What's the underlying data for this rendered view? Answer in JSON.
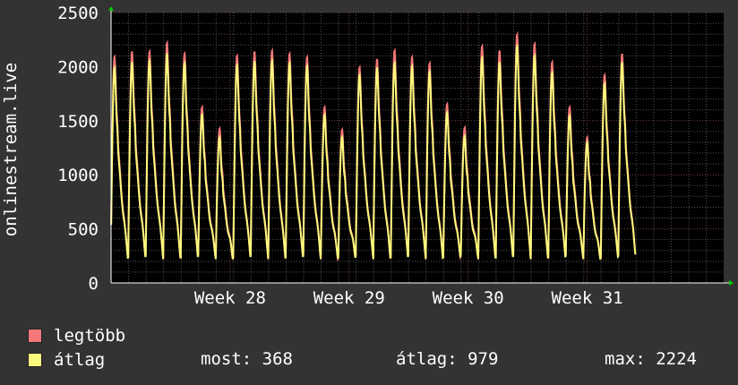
{
  "chart_data": {
    "type": "line",
    "ylabel": "onlinestream.live",
    "ylim": [
      0,
      2500
    ],
    "yticks": [
      0,
      500,
      1000,
      1500,
      2000,
      2500
    ],
    "x_unit": "day",
    "xlim": [
      0,
      35
    ],
    "x_ticks": [
      {
        "label": "Week 28",
        "x": 6.8
      },
      {
        "label": "Week 29",
        "x": 13.6
      },
      {
        "label": "Week 30",
        "x": 20.4
      },
      {
        "label": "Week 31",
        "x": 27.2
      }
    ],
    "grid": true,
    "daily_peaks": [
      {
        "day": 0.2,
        "max": 2100,
        "avg": 2000
      },
      {
        "day": 1.2,
        "max": 2150,
        "avg": 2050
      },
      {
        "day": 2.2,
        "max": 2150,
        "avg": 2060
      },
      {
        "day": 3.2,
        "max": 2230,
        "avg": 2120
      },
      {
        "day": 4.2,
        "max": 2130,
        "avg": 2040
      },
      {
        "day": 5.2,
        "max": 1630,
        "avg": 1560
      },
      {
        "day": 6.2,
        "max": 1430,
        "avg": 1350
      },
      {
        "day": 7.2,
        "max": 2110,
        "avg": 2020
      },
      {
        "day": 8.2,
        "max": 2150,
        "avg": 2060
      },
      {
        "day": 9.2,
        "max": 2160,
        "avg": 2060
      },
      {
        "day": 10.2,
        "max": 2130,
        "avg": 2040
      },
      {
        "day": 11.2,
        "max": 2100,
        "avg": 2010
      },
      {
        "day": 12.2,
        "max": 1630,
        "avg": 1560
      },
      {
        "day": 13.2,
        "max": 1420,
        "avg": 1350
      },
      {
        "day": 14.2,
        "max": 2000,
        "avg": 1930
      },
      {
        "day": 15.2,
        "max": 2080,
        "avg": 2000
      },
      {
        "day": 16.2,
        "max": 2160,
        "avg": 2040
      },
      {
        "day": 17.2,
        "max": 2100,
        "avg": 2010
      },
      {
        "day": 18.2,
        "max": 2040,
        "avg": 1960
      },
      {
        "day": 19.2,
        "max": 1660,
        "avg": 1580
      },
      {
        "day": 20.2,
        "max": 1440,
        "avg": 1360
      },
      {
        "day": 21.2,
        "max": 2200,
        "avg": 2090
      },
      {
        "day": 22.2,
        "max": 2160,
        "avg": 2050
      },
      {
        "day": 23.2,
        "max": 2310,
        "avg": 2200
      },
      {
        "day": 24.2,
        "max": 2220,
        "avg": 2110
      },
      {
        "day": 25.2,
        "max": 2050,
        "avg": 1950
      },
      {
        "day": 26.2,
        "max": 1630,
        "avg": 1550
      },
      {
        "day": 27.2,
        "max": 1350,
        "avg": 1300
      },
      {
        "day": 28.2,
        "max": 1930,
        "avg": 1850
      },
      {
        "day": 29.2,
        "max": 2130,
        "avg": 2050
      }
    ],
    "series": [
      {
        "name": "legtöbb",
        "color": "#f47779"
      },
      {
        "name": "átlag",
        "color": "#fbf97c"
      }
    ]
  },
  "legend": {
    "max_label": "legtöbb",
    "avg_label": "átlag",
    "max_color": "#f47779",
    "avg_color": "#fbf97c"
  },
  "stats": {
    "current": "most: 368",
    "average": "átlag: 979",
    "maximum": "max: 2224"
  }
}
